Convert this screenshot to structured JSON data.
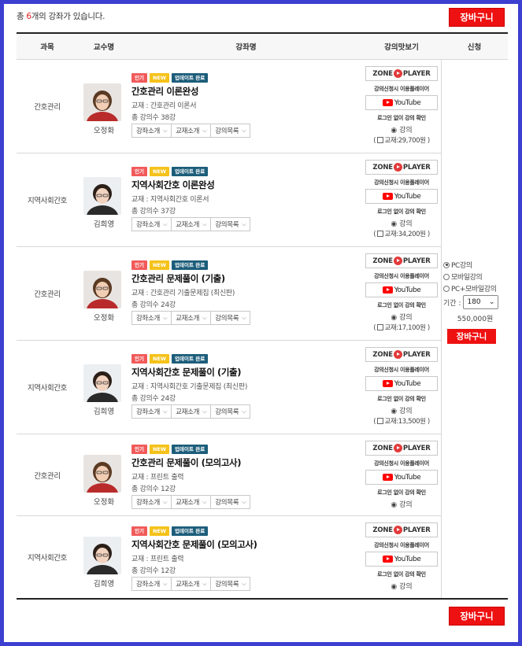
{
  "header": {
    "prefix": "총 ",
    "count": "6",
    "suffix": "개의 강좌가 있습니다.",
    "cart_label": "장바구니"
  },
  "table_headers": {
    "subject": "과목",
    "professor": "교수명",
    "course": "강좌명",
    "preview": "강의맛보기",
    "apply": "신청"
  },
  "badges": {
    "hot": "인기",
    "new": "NEW",
    "updated": "업데이트 완료"
  },
  "preview_labels": {
    "zone_left": "ZONE",
    "zone_right": "PLAYER",
    "zone_note": "강의신청시 이용플레이어",
    "youtube": "YouTube",
    "yt_note": "로그인 없이 강의 확인",
    "lecture": "강의",
    "book_prefix": "( ",
    "book_suffix": " )"
  },
  "select_labels": {
    "intro": "강좌소개",
    "book": "교재소개",
    "list": "강의목록"
  },
  "courses": [
    {
      "subject": "간호관리",
      "professor": "오정화",
      "title": "간호관리 이론완성",
      "book": "교재 : 간호관리 이론서",
      "lessons": "총 강의수 38강",
      "book_price": "교재:29,700원"
    },
    {
      "subject": "지역사회간호",
      "professor": "김희영",
      "title": "지역사회간호 이론완성",
      "book": "교재 : 지역사회간호 이론서",
      "lessons": "총 강의수 37강",
      "book_price": "교재:34,200원"
    },
    {
      "subject": "간호관리",
      "professor": "오정화",
      "title": "간호관리 문제풀이 (기출)",
      "book": "교재 : 간호관리 기출문제집 (최신판)",
      "lessons": "총 강의수 24강",
      "book_price": "교재:17,100원"
    },
    {
      "subject": "지역사회간호",
      "professor": "김희영",
      "title": "지역사회간호 문제풀이 (기출)",
      "book": "교재 : 지역사회간호 기출문제집 (최신판)",
      "lessons": "총 강의수 24강",
      "book_price": "교재:13,500원"
    },
    {
      "subject": "간호관리",
      "professor": "오정화",
      "title": "간호관리 문제풀이 (모의고사)",
      "book": "교재 : 프린트 출력",
      "lessons": "총 강의수 12강",
      "book_price": ""
    },
    {
      "subject": "지역사회간호",
      "professor": "김희영",
      "title": "지역사회간호 문제풀이 (모의고사)",
      "book": "교재 : 프린트 출력",
      "lessons": "총 강의수 12강",
      "book_price": ""
    }
  ],
  "apply": {
    "options": [
      "PC강의",
      "모바일강의",
      "PC+모바일강의"
    ],
    "selected_option": "PC강의",
    "period_label": "기간 :",
    "period_value": "180",
    "price": "550,000원",
    "cart_label": "장바구니"
  },
  "colors": {
    "frame": "#3c3fd0",
    "cart": "#ee1111",
    "badge_hot": "#f15a5a",
    "badge_new": "#f5c21a",
    "badge_updated": "#1c5d7a"
  }
}
